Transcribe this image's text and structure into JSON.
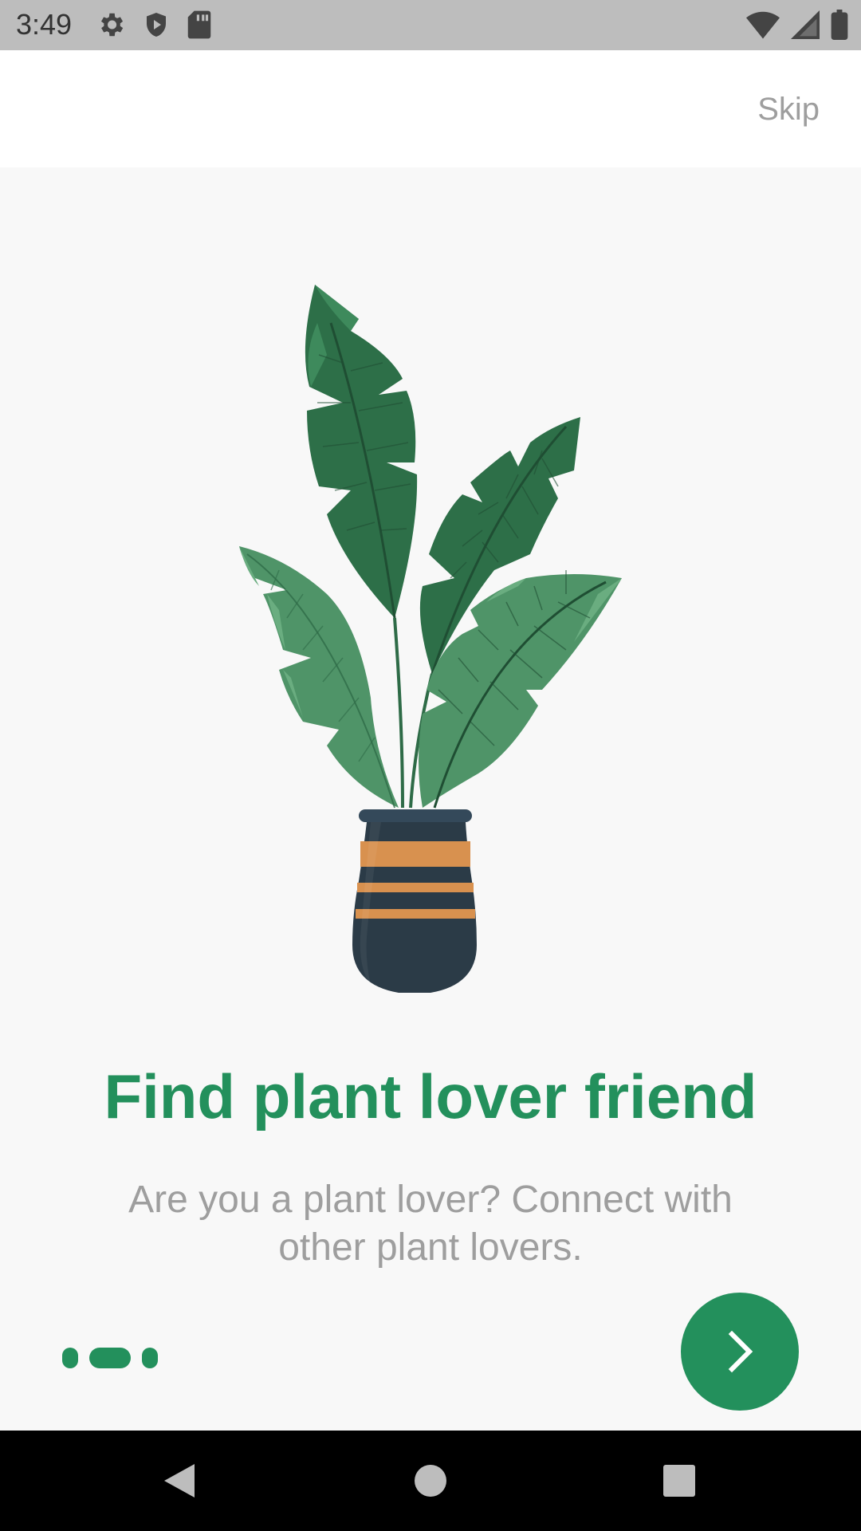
{
  "status_bar": {
    "time": "3:49",
    "left_icons": [
      "gear-icon",
      "shield-icon",
      "sd-card-icon"
    ],
    "right_icons": [
      "wifi-icon",
      "cellular-signal-icon",
      "battery-icon"
    ]
  },
  "top_bar": {
    "skip_label": "Skip"
  },
  "onboarding": {
    "illustration": "potted-plant-illustration",
    "title": "Find plant lover friend",
    "description": "Are you a plant lover? Connect with other plant lovers.",
    "pager": {
      "total": 3,
      "current_index": 1
    },
    "next_icon": "chevron-right-icon"
  },
  "nav_bar": {
    "buttons": [
      "back-triangle-icon",
      "home-circle-icon",
      "recents-square-icon"
    ]
  },
  "colors": {
    "accent": "#23905c",
    "status_bar": "#bdbdbd",
    "background": "#f8f8f8",
    "muted_text": "#9e9e9e",
    "pot": "#2b3b47",
    "pot_stripe": "#d8914f"
  }
}
